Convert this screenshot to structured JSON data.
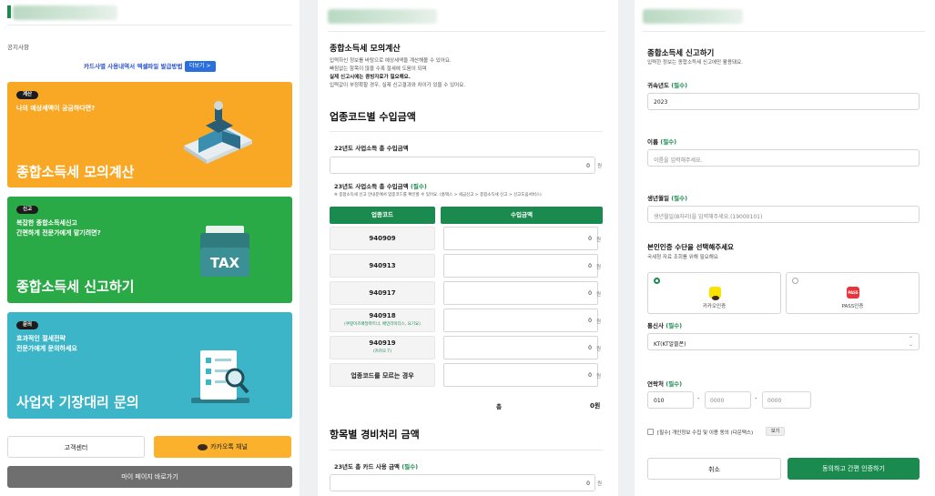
{
  "left": {
    "notice_label": "공지사항",
    "notice_link": "카드사별 사용내역서 엑셀파일 발급방법",
    "more_button": "더보기 >",
    "cards": [
      {
        "chip": "계산",
        "desc": "나의 예상세액이 궁금하다면?",
        "title": "종합소득세 모의계산",
        "color": "#f9a825"
      },
      {
        "chip": "신고",
        "desc1": "복잡한 종합소득세신고",
        "desc2": "간편하게 전문가에게 맡기려면?",
        "title": "종합소득세 신고하기",
        "color": "#2aaa47"
      },
      {
        "chip": "문의",
        "desc1": "효과적인 절세전략",
        "desc2": "전문가에게 문의하세요",
        "title": "사업자 기장대리 문의",
        "color": "#3cb5c8"
      }
    ],
    "tax_badge": "TAX",
    "customer_center": "고객센터",
    "kakao_channel": "카카오톡 채널",
    "mypage": "마이 페이지 바로가기"
  },
  "middle": {
    "title": "종합소득세 모의계산",
    "intro": [
      "입력하신 정보를 바탕으로 예상세액을 계산해볼 수 있어요.",
      "빠짐없는 항목이 많을 수록 절세에 도움이 되며",
      "실제 신고시에는 증빙자료가 필요해요.",
      "입력값이 부정확할 경우, 실제 신고결과와 차이가 있을 수 있어요."
    ],
    "section_income": "업종코드별 수입금액",
    "income22_label": "22년도 사업소득 총 수입금액",
    "income22_value": "0",
    "unit": "원",
    "income23_label": "23년도 사업소득 총 수입금액",
    "required": "(필수)",
    "income23_note": "※ 종합소득세 신고 안내문에서 업종코드를 확인할 수 있어요. (홈택스 > 세금신고 > 종합소득세 신고 > 신고도움서비스)",
    "col_code": "업종코드",
    "col_amount": "수입금액",
    "rows": [
      {
        "code": "940909",
        "sub": "",
        "value": "0"
      },
      {
        "code": "940913",
        "sub": "",
        "value": "0"
      },
      {
        "code": "940917",
        "sub": "",
        "value": "0"
      },
      {
        "code": "940918",
        "sub": "(쿠팡이츠배달파트너, 배민라이더스, 요기요)",
        "value": "0"
      },
      {
        "code": "940919",
        "sub": "(카카오 T)",
        "value": "0"
      },
      {
        "code": "업종코드를 모르는 경우",
        "sub": "",
        "value": "0"
      }
    ],
    "total_label": "총",
    "total_value": "0원",
    "section_expense": "항목별 경비처리 금액",
    "card_label": "23년도 총 카드 사용 금액",
    "card_value": "0"
  },
  "right": {
    "title": "종합소득세 신고하기",
    "subtitle": "입력한 정보는 종합소득세 신고에만 활용돼요.",
    "required": "(필수)",
    "year_label": "귀속년도",
    "year_value": "2023",
    "name_label": "이름",
    "name_placeholder": "이름을 입력해주세요.",
    "birth_label": "생년월일",
    "birth_placeholder": "생년월일(8자리)을 입력해주세요.(19000101)",
    "auth_title": "본인인증 수단을 선택해주세요",
    "auth_sub": "국세청 자료 조회를 위해 필요해요",
    "kakao_auth": "카카오인증",
    "pass_auth": "PASS인증",
    "kakao_badge": "talk",
    "pass_badge": "PASS",
    "carrier_label": "통신사",
    "carrier_value": "KT(KT알뜰폰)",
    "phone_label": "연락처",
    "phone1": "010",
    "phone2_placeholder": "0000",
    "phone3_placeholder": "0000",
    "dash": "-",
    "consent": "[필수] 개인정보 수집 및 이용 동의 (다운택스)",
    "view": "보기",
    "cancel": "취소",
    "agree": "동의하고 간편 인증하기"
  },
  "colors": {
    "green": "#1a8a4e",
    "orange": "#f9a825",
    "bright_green": "#2aaa47",
    "teal": "#3cb5c8",
    "kakao_yellow": "#fbb12b",
    "blue": "#2b6fdc"
  }
}
